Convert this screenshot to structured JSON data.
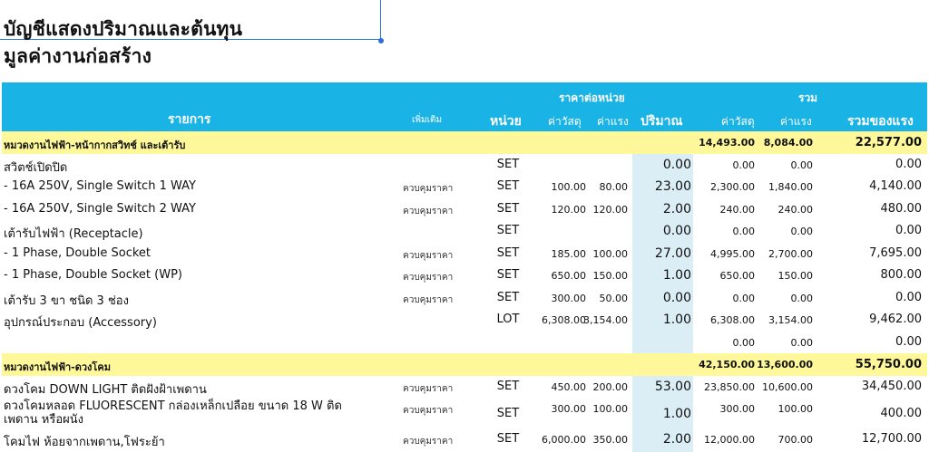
{
  "title": {
    "line1": "บัญชีแสดงปริมาณและต้นทุน",
    "line2": "มูลค่างานก่อสร้าง"
  },
  "header": {
    "unit_price": "ราคาต่อหน่วย",
    "total": "รวม",
    "item": "รายการ",
    "extra": "เพิ่มเติม",
    "unit": "หน่วย",
    "material": "ค่าวัสดุ",
    "labor": "ค่าแรง",
    "quantity": "ปริมาณ",
    "t_material": "ค่าวัสดุ",
    "t_labor": "ค่าแรง",
    "grand_total": "รวมของแรง"
  },
  "rows": [
    {
      "type": "cat",
      "name": "หมวดงานไฟฟ้า-หน้ากากสวิทช์ และเต้ารับ",
      "t_mat": "14,493.00",
      "t_lab": "8,084.00",
      "total": "22,577.00"
    },
    {
      "type": "item",
      "name": "สวิตช์เปิดปิด",
      "extra": "",
      "unit": "SET",
      "mat": "",
      "lab": "",
      "qty": "0.00",
      "t_mat": "0.00",
      "t_lab": "0.00",
      "total": "0.00"
    },
    {
      "type": "item",
      "name": "- 16A 250V, Single Switch 1 WAY",
      "extra": "ควบคุมราคา",
      "unit": "SET",
      "mat": "100.00",
      "lab": "80.00",
      "qty": "23.00",
      "t_mat": "2,300.00",
      "t_lab": "1,840.00",
      "total": "4,140.00"
    },
    {
      "type": "item",
      "name": "- 16A 250V, Single Switch 2 WAY",
      "extra": "ควบคุมราคา",
      "unit": "SET",
      "mat": "120.00",
      "lab": "120.00",
      "qty": "2.00",
      "t_mat": "240.00",
      "t_lab": "240.00",
      "total": "480.00"
    },
    {
      "type": "item",
      "name": "เต้ารับไฟฟ้า (Receptacle)",
      "extra": "",
      "unit": "SET",
      "mat": "",
      "lab": "",
      "qty": "0.00",
      "t_mat": "0.00",
      "t_lab": "0.00",
      "total": "0.00"
    },
    {
      "type": "item",
      "name": "- 1 Phase, Double Socket",
      "extra": "ควบคุมราคา",
      "unit": "SET",
      "mat": "185.00",
      "lab": "100.00",
      "qty": "27.00",
      "t_mat": "4,995.00",
      "t_lab": "2,700.00",
      "total": "7,695.00"
    },
    {
      "type": "item",
      "name": "- 1 Phase, Double Socket (WP)",
      "extra": "ควบคุมราคา",
      "unit": "SET",
      "mat": "650.00",
      "lab": "150.00",
      "qty": "1.00",
      "t_mat": "650.00",
      "t_lab": "150.00",
      "total": "800.00"
    },
    {
      "type": "item",
      "name": "เต้ารับ 3 ขา ชนิด 3 ช่อง",
      "extra": "ควบคุมราคา",
      "unit": "SET",
      "mat": "300.00",
      "lab": "50.00",
      "qty": "0.00",
      "t_mat": "0.00",
      "t_lab": "0.00",
      "total": "0.00"
    },
    {
      "type": "item",
      "name": "อุปกรณ์ประกอบ (Accessory)",
      "extra": "",
      "unit": "LOT",
      "mat": "6,308.00",
      "lab": "3,154.00",
      "qty": "1.00",
      "t_mat": "6,308.00",
      "t_lab": "3,154.00",
      "total": "9,462.00"
    },
    {
      "type": "item",
      "name": "",
      "extra": "",
      "unit": "",
      "mat": "",
      "lab": "",
      "qty": "",
      "t_mat": "0.00",
      "t_lab": "0.00",
      "total": "0.00"
    },
    {
      "type": "cat",
      "name": "หมวดงานไฟฟ้า-ดวงโคม",
      "t_mat": "42,150.00",
      "t_lab": "13,600.00",
      "total": "55,750.00"
    },
    {
      "type": "item",
      "name": "ดวงโคม DOWN LIGHT ติดฝังฝ้าเพดาน",
      "extra": "ควบคุมราคา",
      "unit": "SET",
      "mat": "450.00",
      "lab": "200.00",
      "qty": "53.00",
      "t_mat": "23,850.00",
      "t_lab": "10,600.00",
      "total": "34,450.00"
    },
    {
      "type": "tall",
      "name": "ดวงโคมหลอด FLUORESCENT กล่องเหล็กเปลือย ขนาด 18 W ติดเพดาน หรือผนัง",
      "extra": "ควบคุมราคา",
      "unit": "SET",
      "mat": "300.00",
      "lab": "100.00",
      "qty": "1.00",
      "t_mat": "300.00",
      "t_lab": "100.00",
      "total": "400.00"
    },
    {
      "type": "item",
      "name": "โคมไฟ ห้อยจากเพดาน,โฟระย้า",
      "extra": "ควบคุมราคา",
      "unit": "SET",
      "mat": "6,000.00",
      "lab": "350.00",
      "qty": "2.00",
      "t_mat": "12,000.00",
      "t_lab": "700.00",
      "total": "12,700.00"
    }
  ]
}
